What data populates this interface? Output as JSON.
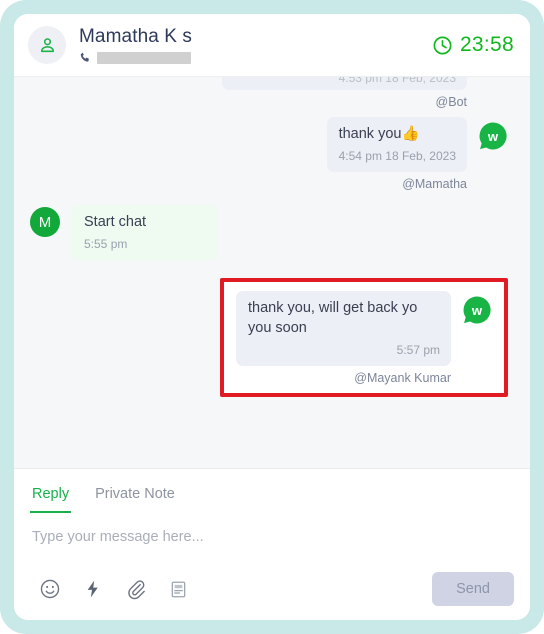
{
  "header": {
    "contact_name": "Mamatha K s",
    "phone_redacted": true,
    "timer": "23:58",
    "avatar_icon": "person-icon",
    "phone_icon": "phone-icon",
    "clock_icon": "clock-icon",
    "timer_color": "#10b81e"
  },
  "conversation": {
    "messages": [
      {
        "id": "m0",
        "direction": "out",
        "clipped": true,
        "text": "",
        "time": "4:53 pm 18 Feb, 2023",
        "attribution": "@Bot",
        "channel_badge": "wati-icon"
      },
      {
        "id": "m1",
        "direction": "out",
        "clipped": false,
        "text": "thank you👍",
        "time": "4:54 pm 18 Feb, 2023",
        "attribution": "@Mamatha",
        "channel_badge": "wati-icon"
      },
      {
        "id": "m2",
        "direction": "in",
        "clipped": false,
        "text": "Start chat",
        "time": "5:55 pm",
        "attribution": "",
        "avatar_initial": "M"
      },
      {
        "id": "m3",
        "direction": "out",
        "clipped": false,
        "highlighted": true,
        "text": "thank you, will get back yo you soon",
        "time": "5:57 pm",
        "attribution": "@Mayank Kumar",
        "channel_badge": "wati-icon"
      }
    ]
  },
  "composer": {
    "tabs": [
      {
        "label": "Reply",
        "active": true
      },
      {
        "label": "Private Note",
        "active": false
      }
    ],
    "input_value": "",
    "input_placeholder": "Type your message here...",
    "tools": [
      {
        "name": "emoji-icon",
        "title": "Emoji"
      },
      {
        "name": "lightning-icon",
        "title": "Quick replies"
      },
      {
        "name": "attachment-icon",
        "title": "Attach file"
      },
      {
        "name": "template-icon",
        "title": "Templates"
      }
    ],
    "send_label": "Send",
    "send_enabled": false
  },
  "colors": {
    "frame": "#c9e8e8",
    "accent_green": "#17b04b",
    "highlight_red": "#e01b24",
    "bubble_out": "#eceff5",
    "bubble_in": "#effbf1",
    "message_bg": "#f6f7f9"
  }
}
